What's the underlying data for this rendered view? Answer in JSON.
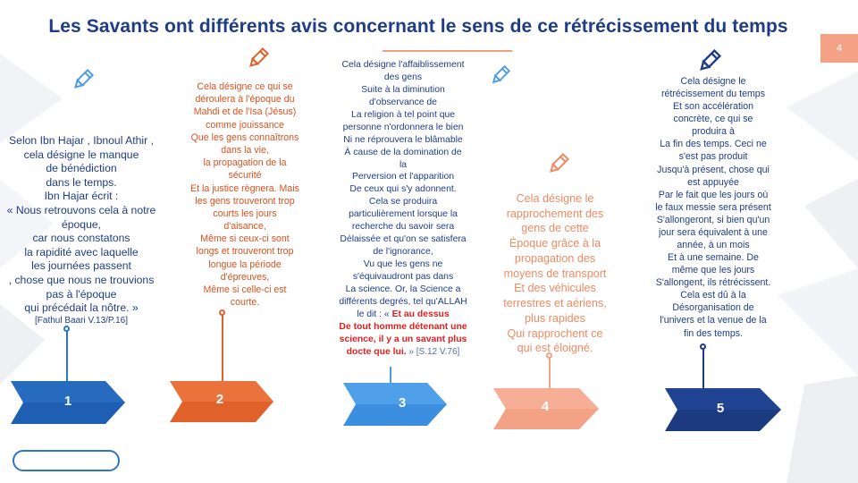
{
  "slide": {
    "title": "Les Savants ont différents avis concernant le sens de ce rétrécissement du temps",
    "page_number": "4"
  },
  "colors": {
    "navy": "#1f3c88",
    "blue": "#2e75c9",
    "light_blue": "#4a9be6",
    "orange": "#e0622a",
    "salmon": "#f4a285",
    "red": "#e02020"
  },
  "icons": [
    "pencil-icon"
  ],
  "steps": [
    {
      "number": "1",
      "lines": [
        "Selon Ibn Hajar , Ibnoul Athir ,",
        "cela désigne le manque",
        "de bénédiction",
        "dans le temps.",
        "Ibn Hajar écrit :",
        "« Nous retrouvons cela à notre",
        "époque,",
        "car nous constatons",
        "la rapidité avec laquelle",
        "les journées passent",
        ", chose que nous ne trouvions",
        "pas à l'époque",
        "qui précédait la nôtre. »"
      ],
      "source": "[Fathul Baari V.13/P.16]"
    },
    {
      "number": "2",
      "lines": [
        "Cela désigne ce qui se",
        "déroulera à l'époque du",
        "Mahdi et de l'Isa (Jésus)",
        "comme jouissance",
        "Que les gens connaîtrons",
        "dans la vie,",
        "la propagation de la",
        "sécurité",
        "Et la justice règnera. Mais",
        "les gens trouveront trop",
        "courts les jours",
        "d'aisance,",
        "Même si ceux-ci sont",
        "longs et trouveront trop",
        "longue la période",
        "d'épreuves,",
        "Même si celle-ci est",
        "courte."
      ]
    },
    {
      "number": "3",
      "lines": [
        "Cela désigne l'affaiblissement",
        "des gens",
        "Suite à la diminution",
        "d'observance de",
        "La religion à tel point que",
        "personne n'ordonnera le bien",
        "Ni ne réprouvera le blâmable",
        "À cause de la domination de",
        "la",
        "Perversion et l'apparition",
        "De ceux qui s'y adonnent.",
        "Cela se produira",
        "particulièrement lorsque la",
        "recherche du savoir sera",
        "Délaissée et qu'on se satisfera",
        "de l'ignorance,",
        "Vu que les gens ne",
        "s'équivaudront pas dans",
        "La science. Or, la Science a",
        "différents degrés, tel qu'ALLAH",
        "le dit : « "
      ],
      "quote_red_1": "Et au dessus",
      "quote_red_lines": [
        "De tout homme détenant une",
        "science, il y a un savant plus",
        "docte que lui."
      ],
      "source": " » [S.12 V.76]"
    },
    {
      "number": "4",
      "lines": [
        "Cela désigne le",
        "rapprochement des",
        "gens de cette",
        "Époque grâce à la",
        "propagation des",
        "moyens de transport",
        "Et des véhicules",
        "terrestres et aériens,",
        "plus rapides",
        "Qui rapprochent ce",
        "qui est éloigné."
      ]
    },
    {
      "number": "5",
      "lines": [
        "Cela désigne le",
        "rétrécissement du temps",
        "Et son accélération",
        "concrète, ce qui se",
        "produira à",
        "La fin des temps. Ceci ne",
        "s'est pas produit",
        "Jusqu'à présent, chose qui",
        "est appuyée",
        "Par le fait que les jours où",
        "le faux messie sera présent",
        "S'allongeront, si bien qu'un",
        "jour sera équivalent à une",
        "année, à un mois",
        "Et à une semaine. De",
        "même que les jours",
        "S'allongent, ils rétrécissent.",
        "Cela est dû à la",
        "Désorganisation de",
        "l'univers et la venue de la",
        "fin des temps."
      ]
    }
  ]
}
